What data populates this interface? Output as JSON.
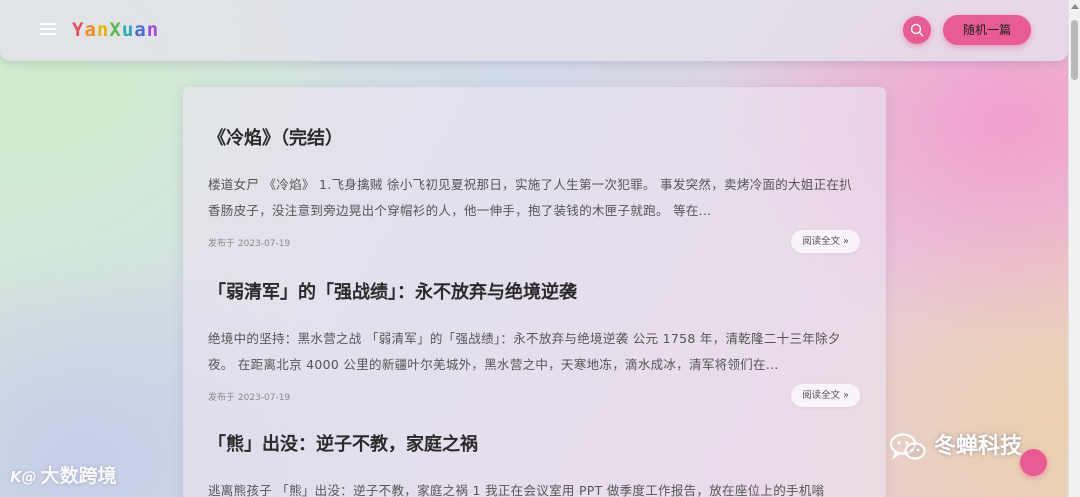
{
  "header": {
    "logo_letters": [
      {
        "ch": "Y",
        "color": "#e84a5f"
      },
      {
        "ch": "a",
        "color": "#f28c28"
      },
      {
        "ch": "n",
        "color": "#e8b400"
      },
      {
        "ch": "X",
        "color": "#5ab552"
      },
      {
        "ch": "u",
        "color": "#2aa7b8"
      },
      {
        "ch": "a",
        "color": "#4a6fd8"
      },
      {
        "ch": "n",
        "color": "#a24ad8"
      }
    ],
    "random_label": "随机一篇",
    "icons": {
      "menu": "hamburger-menu-icon",
      "search": "search-icon"
    }
  },
  "posts": [
    {
      "title": "《冷焰》（完结）",
      "excerpt": "楼道女尸 《冷焰》 1.飞身擒贼 徐小飞初见夏祝那日，实施了人生第一次犯罪。 事发突然，卖烤冷面的大姐正在扒香肠皮子，没注意到旁边晃出个穿帽衫的人，他一伸手，抱了装钱的木匣子就跑。 等在...",
      "date": "发布于 2023-07-19",
      "read_more": "阅读全文 »"
    },
    {
      "title": "「弱清军」的「强战绩」：永不放弃与绝境逆袭",
      "excerpt": "绝境中的坚持：黑水营之战 「弱清军」的「强战绩」：永不放弃与绝境逆袭 公元 1758 年，清乾隆二十三年除夕夜。 在距离北京 4000 公里的新疆叶尔羌城外，黑水营之中，天寒地冻，滴水成冰，清军将领们在...",
      "date": "发布于 2023-07-19",
      "read_more": "阅读全文 »"
    },
    {
      "title": "「熊」出没：逆子不教，家庭之祸",
      "excerpt": "逃离熊孩子 「熊」出没：逆子不教，家庭之祸 1 我正在会议室用 PPT 做季度工作报告，放在座位上的手机嗡",
      "date": "",
      "read_more": ""
    }
  ],
  "watermarks": {
    "left": {
      "logo": "K@",
      "text": "大数跨境"
    },
    "right": {
      "icon": "wechat-icon",
      "text": "冬蝉科技"
    }
  },
  "colors": {
    "accent": "#e85b93"
  }
}
